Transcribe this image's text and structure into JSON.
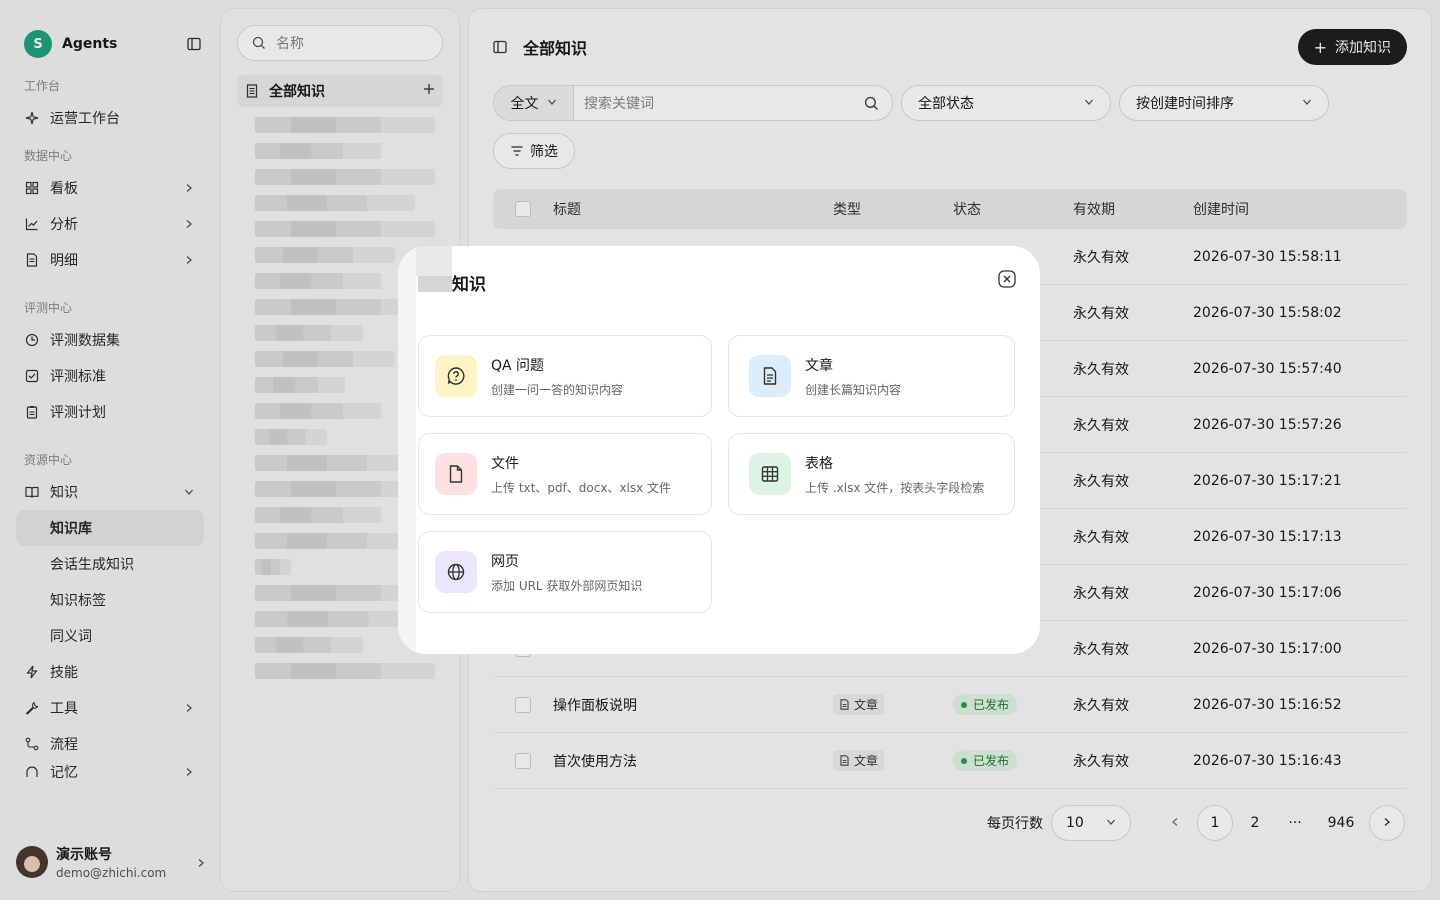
{
  "sidebar": {
    "brand_initial": "S",
    "brand_name": "Agents",
    "sections": {
      "workbench_label": "工作台",
      "data_label": "数据中心",
      "eval_label": "评测中心",
      "resource_label": "资源中心"
    },
    "items": {
      "ops_workbench": "运营工作台",
      "dashboard": "看板",
      "analysis": "分析",
      "detail": "明细",
      "eval_dataset": "评测数据集",
      "eval_standard": "评测标准",
      "eval_plan": "评测计划",
      "knowledge": "知识",
      "knowledge_base": "知识库",
      "session_knowledge": "会话生成知识",
      "knowledge_tags": "知识标签",
      "synonyms": "同义词",
      "skills": "技能",
      "tools": "工具",
      "flows": "流程",
      "memory": "记忆"
    },
    "account": {
      "name": "演示账号",
      "email": "demo@zhichi.com"
    }
  },
  "tree": {
    "search_placeholder": "名称",
    "root_label": "全部知识"
  },
  "main": {
    "title": "全部知识",
    "add_button": "添加知识",
    "search_scope": "全文",
    "search_placeholder": "搜索关键词",
    "status_select": "全部状态",
    "sort_select": "按创建时间排序",
    "filter_button": "筛选",
    "columns": [
      "标题",
      "类型",
      "状态",
      "有效期",
      "创建时间"
    ],
    "rows": [
      {
        "title": "",
        "type": "",
        "status": "",
        "validity": "永久有效",
        "created": "2026-07-30 15:58:11"
      },
      {
        "title": "",
        "type": "",
        "status": "",
        "validity": "永久有效",
        "created": "2026-07-30 15:58:02"
      },
      {
        "title": "",
        "type": "",
        "status": "",
        "validity": "永久有效",
        "created": "2026-07-30 15:57:40"
      },
      {
        "title": "",
        "type": "",
        "status": "",
        "validity": "永久有效",
        "created": "2026-07-30 15:57:26"
      },
      {
        "title": "",
        "type": "",
        "status": "",
        "validity": "永久有效",
        "created": "2026-07-30 15:17:21"
      },
      {
        "title": "",
        "type": "",
        "status": "",
        "validity": "永久有效",
        "created": "2026-07-30 15:17:13"
      },
      {
        "title": "",
        "type": "",
        "status": "",
        "validity": "永久有效",
        "created": "2026-07-30 15:17:06"
      },
      {
        "title": "",
        "type": "",
        "status": "",
        "validity": "永久有效",
        "created": "2026-07-30 15:17:00"
      },
      {
        "title": "操作面板说明",
        "type": "文章",
        "status": "已发布",
        "validity": "永久有效",
        "created": "2026-07-30 15:16:52"
      },
      {
        "title": "首次使用方法",
        "type": "文章",
        "status": "已发布",
        "validity": "永久有效",
        "created": "2026-07-30 15:16:43"
      }
    ],
    "pagination": {
      "rows_per_page_label": "每页行数",
      "page_size": "10",
      "pages": [
        "1",
        "2",
        "···",
        "946"
      ],
      "current": "1"
    }
  },
  "modal": {
    "title": "知识",
    "options": [
      {
        "key": "qa",
        "title": "QA 问题",
        "desc": "创建一问一答的知识内容",
        "icon": "question-icon",
        "color": "#fdf3c4"
      },
      {
        "key": "article",
        "title": "文章",
        "desc": "创建长篇知识内容",
        "icon": "document-icon",
        "color": "#dcecf9"
      },
      {
        "key": "file",
        "title": "文件",
        "desc": "上传 txt、pdf、docx、xlsx 文件",
        "icon": "file-icon",
        "color": "#fde1e1"
      },
      {
        "key": "table",
        "title": "表格",
        "desc": "上传 .xlsx 文件，按表头字段检索",
        "icon": "table-icon",
        "color": "#dcf3e6"
      },
      {
        "key": "web",
        "title": "网页",
        "desc": "添加 URL 获取外部网页知识",
        "icon": "globe-icon",
        "color": "#ebe6fa"
      }
    ]
  },
  "colors": {
    "accent_dark": "#1f1f1f",
    "brand_green": "#20a37f",
    "status_green": "#22a447"
  }
}
